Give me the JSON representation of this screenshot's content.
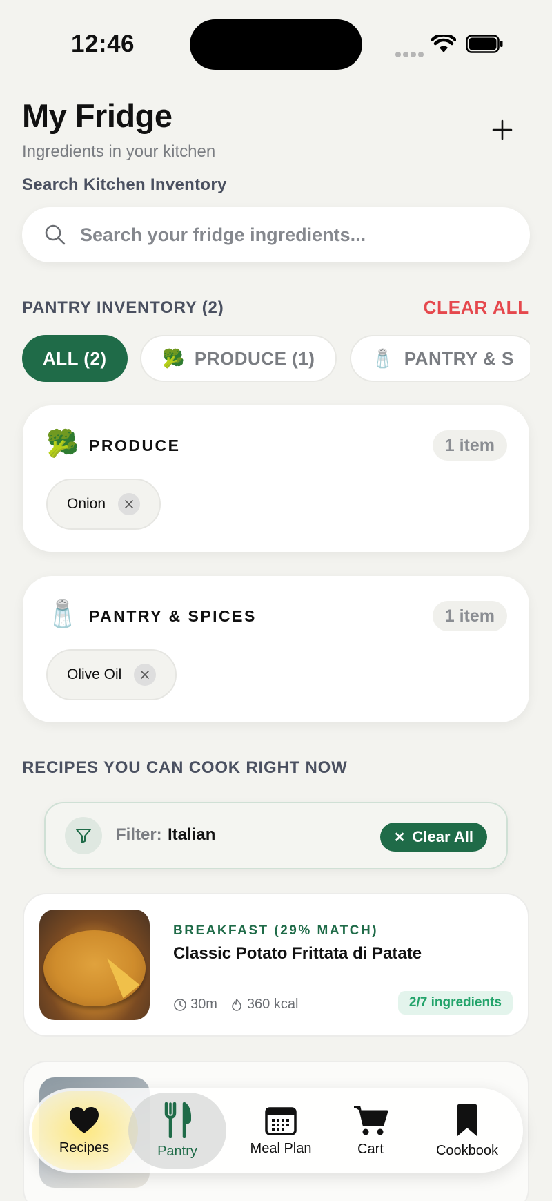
{
  "status_bar": {
    "time": "12:46"
  },
  "header": {
    "title": "My Fridge",
    "subtitle": "Ingredients in your kitchen",
    "add_symbol": "+"
  },
  "search": {
    "label": "Search Kitchen Inventory",
    "placeholder": "Search your fridge ingredients...",
    "value": ""
  },
  "inventory": {
    "title": "PANTRY INVENTORY (2)",
    "clear_label": "CLEAR ALL",
    "chips": [
      {
        "label": "ALL (2)",
        "emoji": "",
        "active": true
      },
      {
        "label": "PRODUCE (1)",
        "emoji": "🥦",
        "active": false
      },
      {
        "label": "PANTRY & S",
        "emoji": "🧂",
        "active": false
      }
    ],
    "categories": [
      {
        "emoji": "🥦",
        "title": "PRODUCE",
        "count": "1 item",
        "items": [
          "Onion"
        ]
      },
      {
        "emoji": "🧂",
        "title": "PANTRY & SPICES",
        "count": "1 item",
        "items": [
          "Olive Oil"
        ]
      }
    ]
  },
  "recipes": {
    "title": "RECIPES YOU CAN COOK RIGHT NOW",
    "filter": {
      "label": "Filter:",
      "value": "Italian",
      "clear_label": "Clear All"
    },
    "cards": [
      {
        "category": "BREAKFAST (29% MATCH)",
        "title": "Classic Potato Frittata di Patate",
        "time": "30m",
        "calories": "360 kcal",
        "ingredients_badge": "2/7 ingredients"
      }
    ]
  },
  "tab_bar": {
    "items": [
      {
        "label": "Recipes",
        "icon": "heart-icon"
      },
      {
        "label": "Pantry",
        "icon": "fork-knife-icon",
        "active": true
      },
      {
        "label": "Meal Plan",
        "icon": "calendar-icon"
      },
      {
        "label": "Cart",
        "icon": "cart-icon"
      },
      {
        "label": "Cookbook",
        "icon": "bookmark-icon"
      }
    ]
  },
  "colors": {
    "accent": "#1f6b48",
    "danger": "#e5484d",
    "background": "#f3f3ef",
    "badge_green": "#22a36a"
  }
}
